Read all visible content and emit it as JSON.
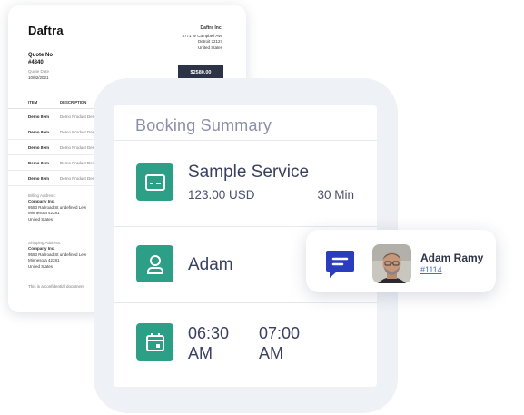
{
  "quote": {
    "logo_text": "Daftra",
    "company_name": "Daftra Inc.",
    "company_address": [
      "3771 W Campbell Ave",
      "Detroit 32127",
      "United States"
    ],
    "quote_label": "Quote No",
    "quote_number": "#4840",
    "date_label": "Quote Date",
    "date_value": "10/02/2021",
    "total": "$2580.00",
    "columns": [
      "ITEM",
      "DESCRIPTION"
    ],
    "rows": [
      {
        "item": "Demo Item",
        "desc": "Demo Product Des"
      },
      {
        "item": "Demo Item",
        "desc": "Demo Product Des"
      },
      {
        "item": "Demo Item",
        "desc": "Demo Product Des"
      },
      {
        "item": "Demo Item",
        "desc": "Demo Product Des"
      },
      {
        "item": "Demo Item",
        "desc": "Demo Product Des"
      }
    ],
    "billing": {
      "label": "Billing Address:",
      "company": "Company Inc.",
      "lines": [
        "9553 Railroad St undefined Lew",
        "Minnesota 42281",
        "United States"
      ]
    },
    "shipping": {
      "label": "Shipping Address:",
      "company": "Company Inc.",
      "lines": [
        "9553 Railroad St undefined Lew",
        "Minnesota 42281",
        "United States"
      ]
    },
    "footnote": "This is a confidential document"
  },
  "booking": {
    "title": "Booking Summary",
    "service_name": "Sample Service",
    "price": "123.00 USD",
    "duration": "30 Min",
    "staff": "Adam",
    "start_time": "06:30",
    "start_period": "AM",
    "end_time": "07:00",
    "end_period": "AM"
  },
  "agent": {
    "name": "Adam Ramy",
    "id": "#1114"
  },
  "colors": {
    "accent_green": "#2e9f87",
    "chat_blue": "#2a3dbf",
    "badge_dark": "#2d3346"
  },
  "icons": {
    "service": "id-card-icon",
    "staff": "person-icon",
    "date": "calendar-icon",
    "chat": "chat-bubble-icon"
  }
}
